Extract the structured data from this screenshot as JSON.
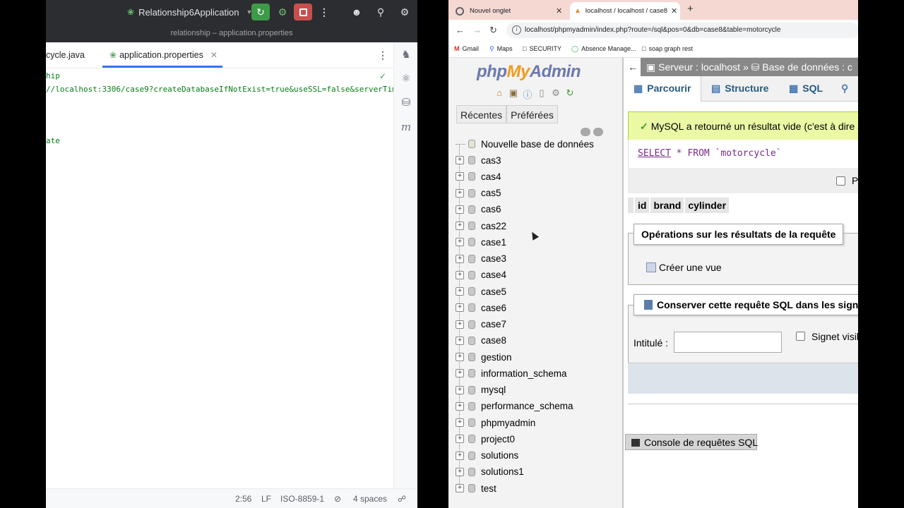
{
  "ide": {
    "run_config": "Relationship6Application",
    "window_title": "relationship – application.properties",
    "tabs": [
      {
        "label": "cycle.java"
      },
      {
        "label": "application.properties"
      }
    ],
    "code_lines": [
      "hip",
      "//localhost:3306/case9?createDatabaseIfNotExist=true&useSSL=false&serverTim",
      "ate"
    ],
    "status": {
      "position": "2:56",
      "line_sep": "LF",
      "encoding": "ISO-8859-1",
      "indent": "4 spaces"
    },
    "icons": {
      "rerun": "rerun-icon",
      "debug": "bug-icon",
      "stop": "stop-icon",
      "more": "more-icon",
      "add_user": "add-user-icon",
      "search": "search-icon",
      "settings": "gear-icon",
      "notifications": "bell-icon",
      "ai": "ai-assistant-icon",
      "database": "database-icon",
      "maven": "maven-icon"
    },
    "colors": {
      "rerun": "#3d9a47",
      "stop": "#c94f4f",
      "accent": "#3574f0",
      "code": "#067d17"
    }
  },
  "browser": {
    "tabs": [
      {
        "label": "Nouvel onglet"
      },
      {
        "label": "localhost / localhost / case8"
      }
    ],
    "url": "localhost/phpmyadmin/index.php?route=/sql&pos=0&db=case8&table=motorcycle",
    "bookmarks": [
      "Gmail",
      "Maps",
      "SECURITY",
      "Absence Manage...",
      "soap graph rest"
    ]
  },
  "pma": {
    "logo": {
      "php": "php",
      "my": "My",
      "admin": "Admin"
    },
    "nav_tabs": [
      "Récentes",
      "Préférées"
    ],
    "new_db": "Nouvelle base de données",
    "databases": [
      "cas3",
      "cas4",
      "cas5",
      "cas6",
      "cas22",
      "case1",
      "case3",
      "case4",
      "case5",
      "case6",
      "case7",
      "case8",
      "gestion",
      "information_schema",
      "mysql",
      "performance_schema",
      "phpmyadmin",
      "project0",
      "solutions",
      "solutions1",
      "test"
    ],
    "breadcrumb": {
      "server": "Serveur : localhost",
      "sep": "»",
      "database": "Base de données : c"
    },
    "menu": {
      "browse": "Parcourir",
      "structure": "Structure",
      "sql": "SQL"
    },
    "success_message": "MySQL a retourné un résultat vide (c'est à dire au",
    "query": {
      "select": "SELECT",
      "star": "*",
      "from": "FROM",
      "table": "`motorcycle`"
    },
    "profile_label": "P",
    "result_columns": [
      "id",
      "brand",
      "cylinder"
    ],
    "ops_legend": "Opérations sur les résultats de la requête",
    "create_view": "Créer une vue",
    "bookmark_legend": "Conserver cette requête SQL dans les signe",
    "bookmark_title_label": "Intitulé :",
    "bookmark_visible_label": "Signet visib",
    "console": "Console de requêtes SQL"
  }
}
